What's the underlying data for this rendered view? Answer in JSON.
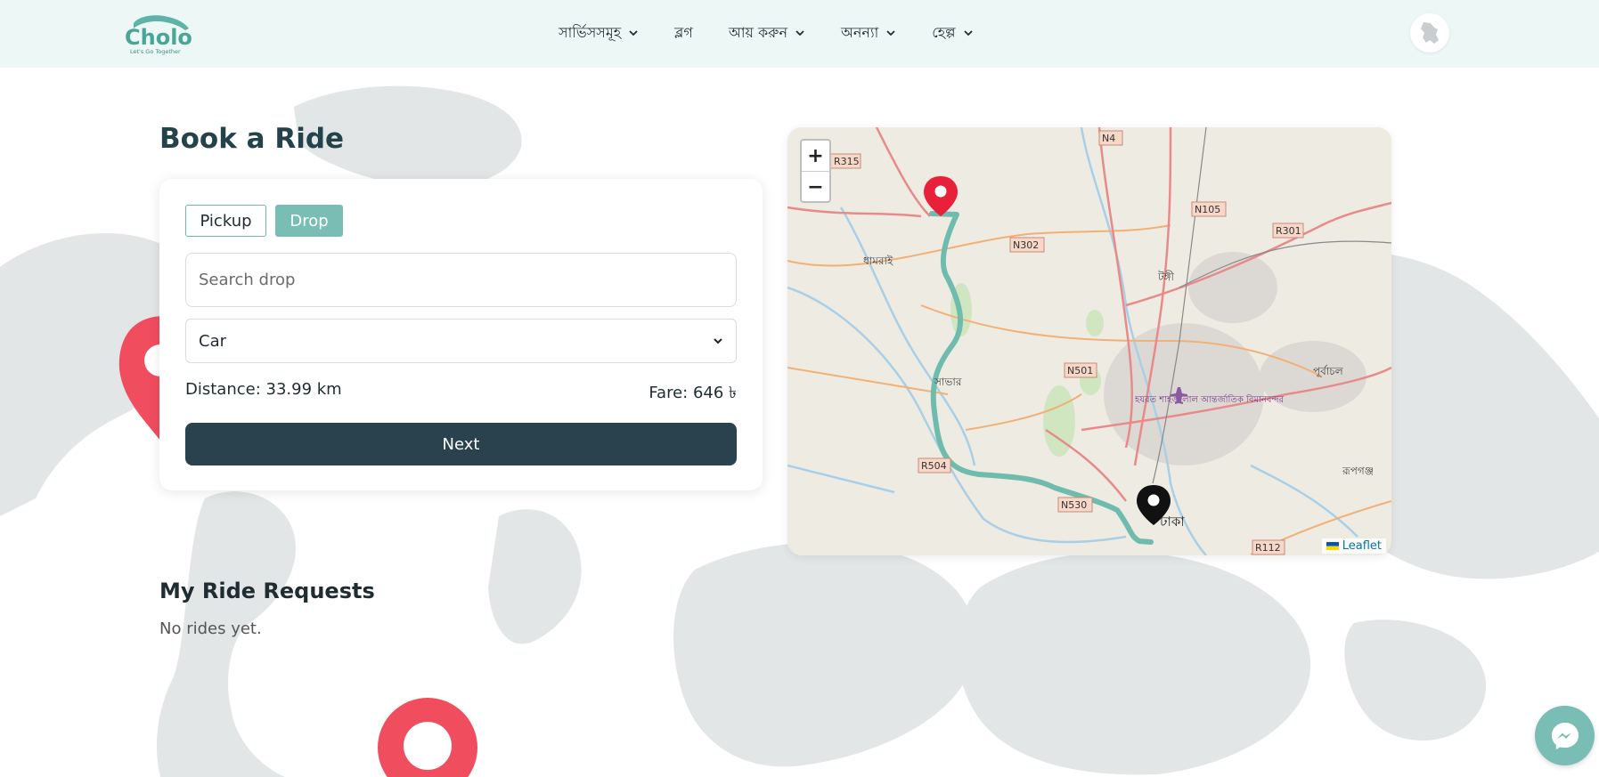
{
  "header": {
    "logo": {
      "brand": "Cholo",
      "tagline": "Let's Go Together"
    },
    "nav": [
      {
        "label": "সার্ভিসসমূহ",
        "dropdown": true
      },
      {
        "label": "ব্লগ",
        "dropdown": false
      },
      {
        "label": "আয় করুন",
        "dropdown": true
      },
      {
        "label": "অনন্যা",
        "dropdown": true
      },
      {
        "label": "হেল্প",
        "dropdown": true
      }
    ],
    "language_icon": "bangladesh-map-icon"
  },
  "booking": {
    "title": "Book a Ride",
    "tabs": {
      "pickup": "Pickup",
      "drop": "Drop",
      "active": "Drop"
    },
    "search_placeholder": "Search drop",
    "vehicle": "Car",
    "distance": "Distance: 33.99 km",
    "fare": "Fare: 646 ৳",
    "next_label": "Next"
  },
  "map": {
    "zoom_in": "+",
    "zoom_out": "−",
    "attribution": "Leaflet",
    "road_labels": [
      "R315",
      "N4",
      "N105",
      "R301",
      "N302",
      "N501",
      "R504",
      "N530",
      "R112"
    ],
    "place_labels": [
      "ধামরাই",
      "টঙ্গী",
      "সাভার",
      "পূর্বাচল",
      "রূপগঞ্জ",
      "হযরত শাহজালাল আন্তর্জাতিক বিমানবন্দর",
      "ঢাকা"
    ],
    "route_color": "#6fbcae",
    "pickup_marker_color": "#e8203a",
    "drop_marker_color": "#111111"
  },
  "requests": {
    "title": "My Ride Requests",
    "empty_text": "No rides yet."
  },
  "colors": {
    "accent": "#79bdb4",
    "dark_button": "#2a424d",
    "header_bg": "#ecf7f6"
  }
}
